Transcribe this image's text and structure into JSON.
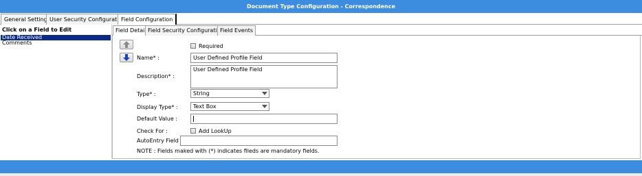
{
  "window": {
    "title": "Document Type Configuration - Correspondence"
  },
  "outer_tabs": [
    "General Settings",
    "User Security Configuration",
    "Field Configuration"
  ],
  "left_panel": {
    "header": "Click on a Field to Edit",
    "fields": [
      "Date Received",
      "Comments"
    ]
  },
  "inner_tabs": [
    "Field Detail",
    "Field Security Configuration",
    "Field Events"
  ],
  "form": {
    "required_label": "Required",
    "name_label": "Name* :",
    "name_value": "User Defined Profile Field",
    "description_label": "Description* :",
    "description_value": "User Defined Profile Field",
    "type_label": "Type* :",
    "type_value": "String",
    "display_type_label": "Display Type* :",
    "display_type_value": "Text Box",
    "default_value_label": "Default Value :",
    "default_value": "",
    "check_for_label": "Check For :",
    "add_lookup_label": "Add LookUp",
    "autoentry_label": "AutoEntry Field Name :",
    "autoentry_value": "",
    "note": "NOTE : Fields maked with (*) indicates fileds are mandatory fields."
  },
  "colors": {
    "title_bar": "#3c8de0",
    "selection": "#0a2a8a",
    "arrow_up": "#8a8a8a",
    "arrow_down": "#1a3fbf"
  },
  "icons": {
    "move_up": "arrow-up-icon",
    "move_down": "arrow-down-icon",
    "dropdown": "chevron-down-icon"
  }
}
